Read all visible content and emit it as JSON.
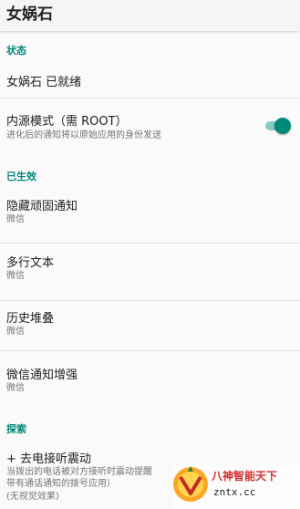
{
  "appbar": {
    "title": "女娲石"
  },
  "sections": {
    "status": {
      "header": "状态",
      "ready_text": "女娲石 已就绪",
      "inbound_mode": {
        "title": "内源模式（需 ROOT）",
        "summary": "进化后的通知将以原始应用的身份发送",
        "enabled": true
      }
    },
    "active": {
      "header": "已生效",
      "items": [
        {
          "title": "隐藏顽固通知",
          "summary": "微信"
        },
        {
          "title": "多行文本",
          "summary": "微信"
        },
        {
          "title": "历史堆叠",
          "summary": "微信"
        },
        {
          "title": "微信通知增强",
          "summary": "微信"
        }
      ]
    },
    "explore": {
      "header": "探索",
      "item": {
        "title": "+ 去电接听震动",
        "summary_line1": "当拨出的电话被对方接听时震动提醒",
        "summary_line2": "带有通话通知的拨号应用）",
        "summary_line3": "(无视觉效果)"
      }
    }
  },
  "watermark": {
    "line1": "八神智能天下",
    "line2": "zntx.cc"
  },
  "colors": {
    "accent": "#00897b",
    "accent_light": "#80cbc4",
    "divider": "#e0e0e0"
  }
}
